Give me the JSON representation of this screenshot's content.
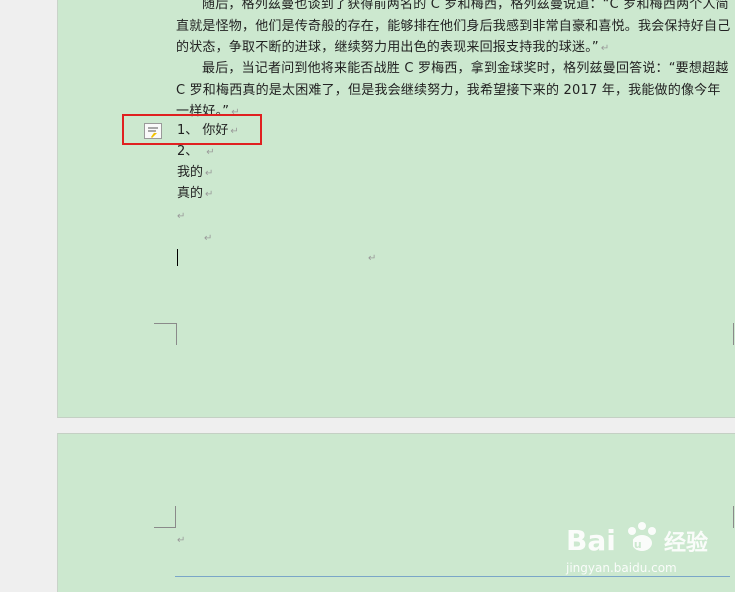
{
  "document": {
    "paragraph1": "随后，格列兹曼也谈到了获得前两名的 C 罗和梅西，格列兹曼说道：“C 罗和梅西两个人简直就是怪物，他们是传奇般的存在，能够排在他们身后我感到非常自豪和喜悦。我会保持好自己的状态，争取不断的进球，继续努力用出色的表现来回报支持我的球迷。”",
    "paragraph2": "最后，当记者问到他将来能否战胜 C 罗梅西，拿到金球奖时，格列兹曼回答说：“要想超越 C 罗和梅西真的是太困难了，但是我会继续努力，我希望接下来的 2017 年，我能做的像今年一样好。”",
    "list_item_1": "1、 你好",
    "list_item_2": "2、",
    "line_3": "我的",
    "line_4": "真的",
    "paragraph_mark": "↵"
  },
  "watermark": {
    "logo": "Bai du 经验",
    "url": "jingyan.baidu.com"
  },
  "colors": {
    "page_background": "#cce8cf",
    "highlight_box": "#e02020"
  }
}
